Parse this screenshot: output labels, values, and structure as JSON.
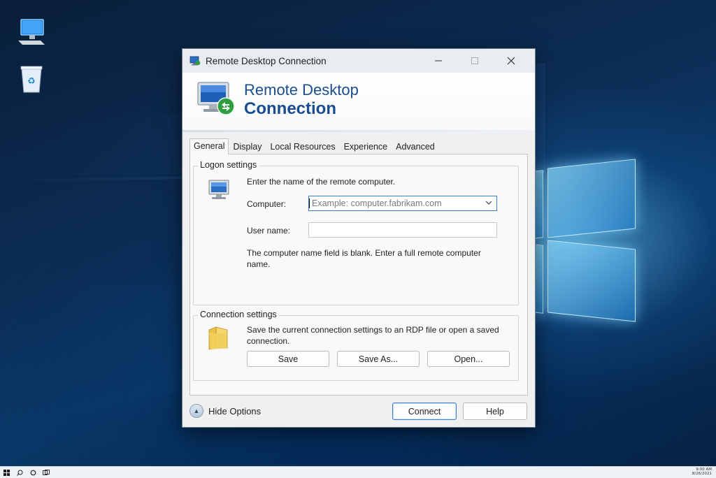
{
  "window": {
    "title": "Remote Desktop Connection",
    "controls": {
      "minimize": "—",
      "maximize": "☐",
      "close": "✕"
    }
  },
  "banner": {
    "line1": "Remote Desktop",
    "line2": "Connection"
  },
  "tabs": [
    "General",
    "Display",
    "Local Resources",
    "Experience",
    "Advanced"
  ],
  "active_tab": "General",
  "logon": {
    "group_label": "Logon settings",
    "instruction": "Enter the name of the remote computer.",
    "computer_label": "Computer:",
    "computer_placeholder": "Example: computer.fabrikam.com",
    "username_label": "User name:",
    "username_value": "",
    "warning": "The computer name field is blank. Enter a full remote computer name."
  },
  "connection": {
    "group_label": "Connection settings",
    "description": "Save the current connection settings to an RDP file or open a saved connection.",
    "save": "Save",
    "save_as": "Save As...",
    "open": "Open..."
  },
  "footer": {
    "hide_options": "Hide Options",
    "connect": "Connect",
    "help": "Help"
  },
  "taskbar": {
    "time": "9:00 AM",
    "date": "8/26/2021"
  },
  "colors": {
    "accent": "#3b7fd1",
    "banner_text": "#1a4d8f",
    "desktop": "#0c2d55"
  }
}
